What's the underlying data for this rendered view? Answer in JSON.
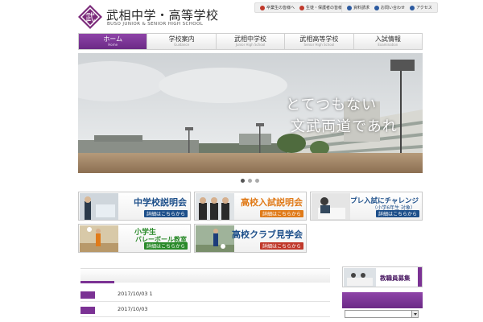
{
  "brand": {
    "name_ja": "武相中学・高等学校",
    "name_en": "BUSO JUNIOR & SENIOR HIGH SCHOOL",
    "logo_kanji": "武",
    "logo_icon": "school-crest-icon"
  },
  "top_links": {
    "group1": [
      {
        "label": "卒業生の皆様へ",
        "color": "#c0392b"
      },
      {
        "label": "生徒・保護者の皆様へ",
        "color": "#c0392b"
      }
    ],
    "group2": [
      {
        "label": "資料請求",
        "color": "#2c5aa0"
      },
      {
        "label": "お問い合わせ",
        "color": "#2c5aa0"
      },
      {
        "label": "アクセス",
        "color": "#2c5aa0"
      }
    ]
  },
  "nav": [
    {
      "label": "ホーム",
      "sub": "Home"
    },
    {
      "label": "学校案内",
      "sub": "Guidance"
    },
    {
      "label": "武相中学校",
      "sub": "Junior High School"
    },
    {
      "label": "武相高等学校",
      "sub": "Senior High School"
    },
    {
      "label": "入試情報",
      "sub": "Examination"
    }
  ],
  "hero": {
    "line1": "とてつもない",
    "line2": "文武両道であれ"
  },
  "banners": [
    {
      "title": "中学校説明会",
      "sub": "",
      "button": "詳細はこちらから",
      "title_color": "#1d4f8a",
      "button_color": "#1d4f8a"
    },
    {
      "title": "高校入試説明会",
      "sub": "",
      "button": "詳細はこちらから",
      "title_color": "#e07b1a",
      "button_color": "#e07b1a"
    },
    {
      "title": "プレ入試にチャレンジ",
      "sub": "（小学6年生 対象）",
      "button": "詳細はこちらから",
      "title_color": "#1d4f8a",
      "button_color": "#1d4f8a"
    },
    {
      "title": "小学生",
      "sub": "バレーボール教室",
      "button": "詳細はこちらから",
      "title_color": "#2a8a2a",
      "button_color": "#2a8a2a"
    },
    {
      "title": "高校クラブ見学会",
      "sub": "",
      "button": "詳細はこちらから",
      "title_color": "#1d4f8a",
      "button_color": "#c0392b"
    }
  ],
  "news": [
    {
      "date": "2017/10/03  1"
    },
    {
      "date": "2017/10/03"
    }
  ],
  "side": {
    "recruit_label": "教職員募集"
  },
  "colors": {
    "brand_purple": "#7b3294"
  }
}
